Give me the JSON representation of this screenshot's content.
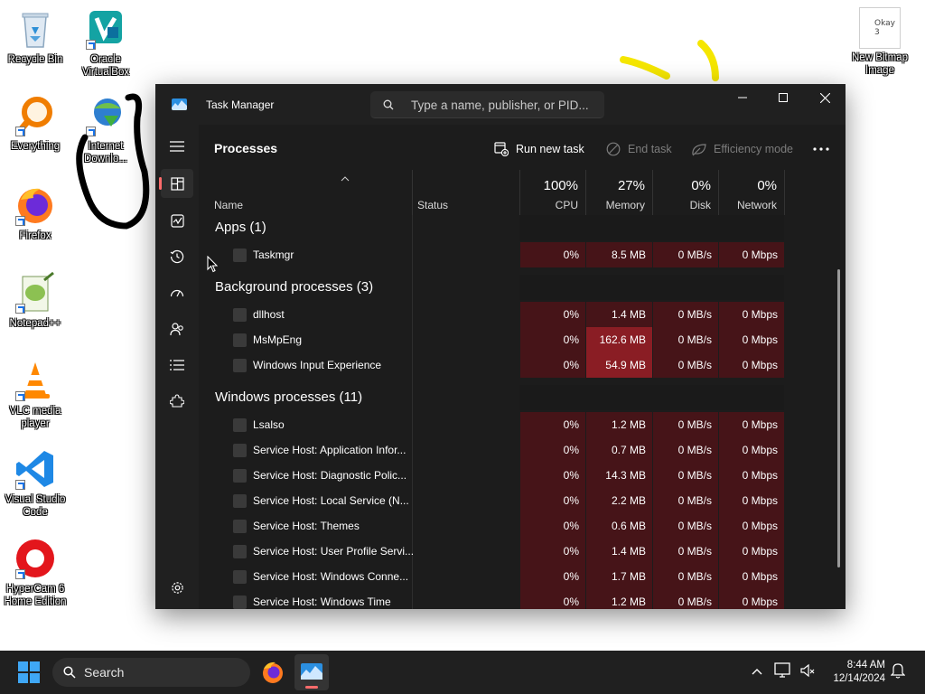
{
  "desktop": {
    "icons": [
      {
        "label": "Recycle Bin"
      },
      {
        "label": "Oracle VirtualBox"
      },
      {
        "label": "Everything"
      },
      {
        "label": "Internet Downlo..."
      },
      {
        "label": "Firefox"
      },
      {
        "label": "Notepad++"
      },
      {
        "label": "VLC media player"
      },
      {
        "label": "Visual Studio Code"
      },
      {
        "label": "HyperCam 6 Home Edition"
      },
      {
        "label": "New Bitmap Image"
      }
    ],
    "bitmap_thumb_text": "Okay 3"
  },
  "task_manager": {
    "title": "Task Manager",
    "search_placeholder": "Type a name, publisher, or PID...",
    "page_title": "Processes",
    "toolbar": {
      "run_new_task": "Run new task",
      "end_task": "End task",
      "efficiency_mode": "Efficiency mode"
    },
    "columns": {
      "name": "Name",
      "status": "Status",
      "cpu": {
        "pct": "100%",
        "label": "CPU"
      },
      "memory": {
        "pct": "27%",
        "label": "Memory"
      },
      "disk": {
        "pct": "0%",
        "label": "Disk"
      },
      "network": {
        "pct": "0%",
        "label": "Network"
      }
    },
    "groups": {
      "apps": "Apps (1)",
      "background": "Background processes (3)",
      "windows": "Windows processes (11)"
    },
    "rows": [
      {
        "name": "Taskmgr",
        "cpu": "0%",
        "mem": "8.5 MB",
        "disk": "0 MB/s",
        "net": "0 Mbps"
      },
      {
        "name": "dllhost",
        "cpu": "0%",
        "mem": "1.4 MB",
        "disk": "0 MB/s",
        "net": "0 Mbps"
      },
      {
        "name": "MsMpEng",
        "cpu": "0%",
        "mem": "162.6 MB",
        "disk": "0 MB/s",
        "net": "0 Mbps"
      },
      {
        "name": "Windows Input Experience",
        "cpu": "0%",
        "mem": "54.9 MB",
        "disk": "0 MB/s",
        "net": "0 Mbps"
      },
      {
        "name": "Lsalso",
        "cpu": "0%",
        "mem": "1.2 MB",
        "disk": "0 MB/s",
        "net": "0 Mbps"
      },
      {
        "name": "Service Host: Application Infor...",
        "cpu": "0%",
        "mem": "0.7 MB",
        "disk": "0 MB/s",
        "net": "0 Mbps"
      },
      {
        "name": "Service Host: Diagnostic Polic...",
        "cpu": "0%",
        "mem": "14.3 MB",
        "disk": "0 MB/s",
        "net": "0 Mbps"
      },
      {
        "name": "Service Host: Local Service (N...",
        "cpu": "0%",
        "mem": "2.2 MB",
        "disk": "0 MB/s",
        "net": "0 Mbps"
      },
      {
        "name": "Service Host: Themes",
        "cpu": "0%",
        "mem": "0.6 MB",
        "disk": "0 MB/s",
        "net": "0 Mbps"
      },
      {
        "name": "Service Host: User Profile Servi...",
        "cpu": "0%",
        "mem": "1.4 MB",
        "disk": "0 MB/s",
        "net": "0 Mbps"
      },
      {
        "name": "Service Host: Windows Conne...",
        "cpu": "0%",
        "mem": "1.7 MB",
        "disk": "0 MB/s",
        "net": "0 Mbps"
      },
      {
        "name": "Service Host: Windows Time",
        "cpu": "0%",
        "mem": "1.2 MB",
        "disk": "0 MB/s",
        "net": "0 Mbps"
      }
    ]
  },
  "taskbar": {
    "search_label": "Search",
    "time": "8:44 AM",
    "date": "12/14/2024"
  },
  "colors": {
    "accent_red": "#ff6b6b",
    "heat_low": "#461418",
    "heat_high": "#8a1d24",
    "scribble_yellow": "#f5e600"
  }
}
